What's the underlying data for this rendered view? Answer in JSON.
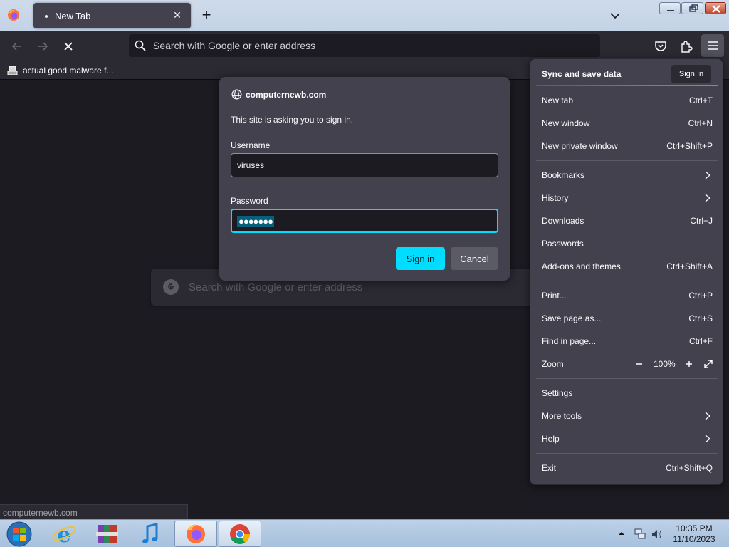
{
  "browser": {
    "tab_title": "New Tab",
    "address_placeholder": "Search with Google or enter address",
    "bookmark_label": "actual good malware f..."
  },
  "newtab": {
    "search_placeholder": "Search with Google or enter address"
  },
  "auth_dialog": {
    "host": "computernewb.com",
    "message": "This site is asking you to sign in.",
    "username_label": "Username",
    "username_value": "viruses",
    "password_label": "Password",
    "password_mask": "●●●●●●●",
    "signin_label": "Sign in",
    "cancel_label": "Cancel"
  },
  "app_menu": {
    "sync_label": "Sync and save data",
    "sync_button": "Sign In",
    "items": [
      {
        "label": "New tab",
        "shortcut": "Ctrl+T"
      },
      {
        "label": "New window",
        "shortcut": "Ctrl+N"
      },
      {
        "label": "New private window",
        "shortcut": "Ctrl+Shift+P"
      },
      {
        "label": "Bookmarks",
        "shortcut": ""
      },
      {
        "label": "History",
        "shortcut": ""
      },
      {
        "label": "Downloads",
        "shortcut": "Ctrl+J"
      },
      {
        "label": "Passwords",
        "shortcut": ""
      },
      {
        "label": "Add-ons and themes",
        "shortcut": "Ctrl+Shift+A"
      },
      {
        "label": "Print...",
        "shortcut": "Ctrl+P"
      },
      {
        "label": "Save page as...",
        "shortcut": "Ctrl+S"
      },
      {
        "label": "Find in page...",
        "shortcut": "Ctrl+F"
      },
      {
        "label": "Zoom",
        "shortcut": ""
      },
      {
        "label": "Settings",
        "shortcut": ""
      },
      {
        "label": "More tools",
        "shortcut": ""
      },
      {
        "label": "Help",
        "shortcut": ""
      },
      {
        "label": "Exit",
        "shortcut": "Ctrl+Shift+Q"
      }
    ],
    "zoom_level": "100%"
  },
  "status": {
    "link": "computernewb.com"
  },
  "taskbar": {
    "time": "10:35 PM",
    "date": "11/10/2023"
  },
  "colors": {
    "accent": "#00ddff",
    "panel": "#42414d",
    "toolbar": "#2b2a33",
    "content_bg": "#1c1b22"
  }
}
